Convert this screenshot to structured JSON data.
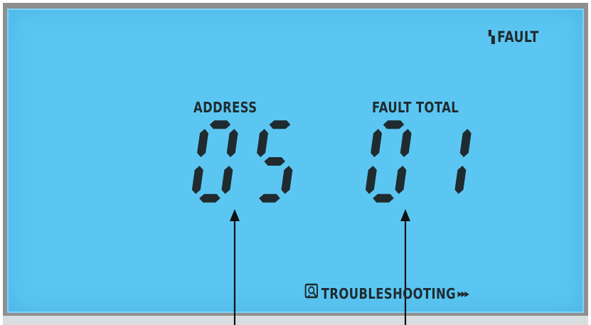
{
  "display": {
    "indicator": {
      "label": "FAULT",
      "icon": "fault-indicator-icon"
    },
    "address": {
      "label": "ADDRESS",
      "value": "05"
    },
    "fault_total": {
      "label": "FAULT TOTAL",
      "value": "01"
    },
    "troubleshooting": {
      "label": "TROUBLESHOOTING",
      "arrows": "▸▸▸",
      "icon": "manual-book-icon"
    },
    "colors": {
      "lcd_background": "#5cc6f2",
      "segment": "#1f2b2f",
      "bezel": "#8f8f8f"
    }
  }
}
